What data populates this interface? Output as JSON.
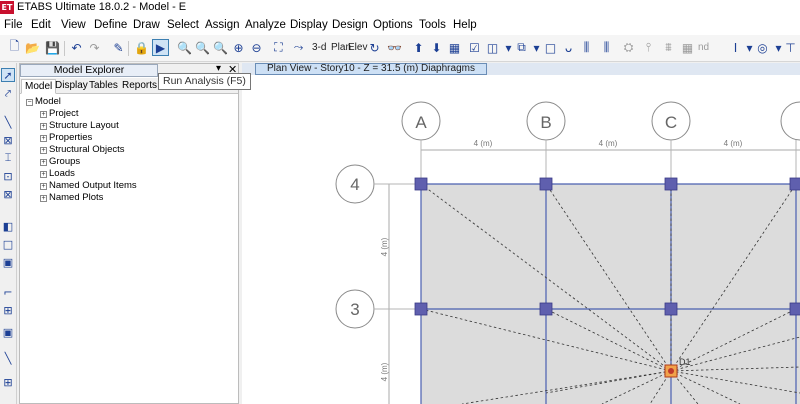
{
  "app": {
    "logo": "ET",
    "title": "ETABS Ultimate 18.0.2 - Model - E"
  },
  "menu": [
    "File",
    "Edit",
    "View",
    "Define",
    "Draw",
    "Select",
    "Assign",
    "Analyze",
    "Display",
    "Design",
    "Options",
    "Tools",
    "Help"
  ],
  "toolbar": {
    "three_d_label": "3-d",
    "plan_label": "Plan",
    "elev_label": "Elev",
    "nd_label": "nd",
    "tooltip": "Run Analysis (F5)"
  },
  "explorer": {
    "title": "Model Explorer",
    "tabs": [
      "Model",
      "Display",
      "Tables",
      "Reports"
    ],
    "root": "Model",
    "items": [
      "Project",
      "Structure Layout",
      "Properties",
      "Structural Objects",
      "Groups",
      "Loads",
      "Named Output Items",
      "Named Plots"
    ]
  },
  "plan_view": {
    "tab_title": "Plan View - Story10 - Z = 31.5 (m)  Diaphragms",
    "grid_columns": [
      "A",
      "B",
      "C"
    ],
    "grid_rows": [
      "4",
      "3"
    ],
    "spacing_x": [
      "4 (m)",
      "4 (m)",
      "4 (m)"
    ],
    "spacing_y": [
      "4 (m)",
      "4 (m)"
    ],
    "point_label": "D1"
  },
  "colors": {
    "accent": "#1c3f94",
    "slab": "#dcdcdc",
    "joint": "#5f5fae",
    "bubble": "#7f7f7f",
    "center_point": "#d35400"
  }
}
